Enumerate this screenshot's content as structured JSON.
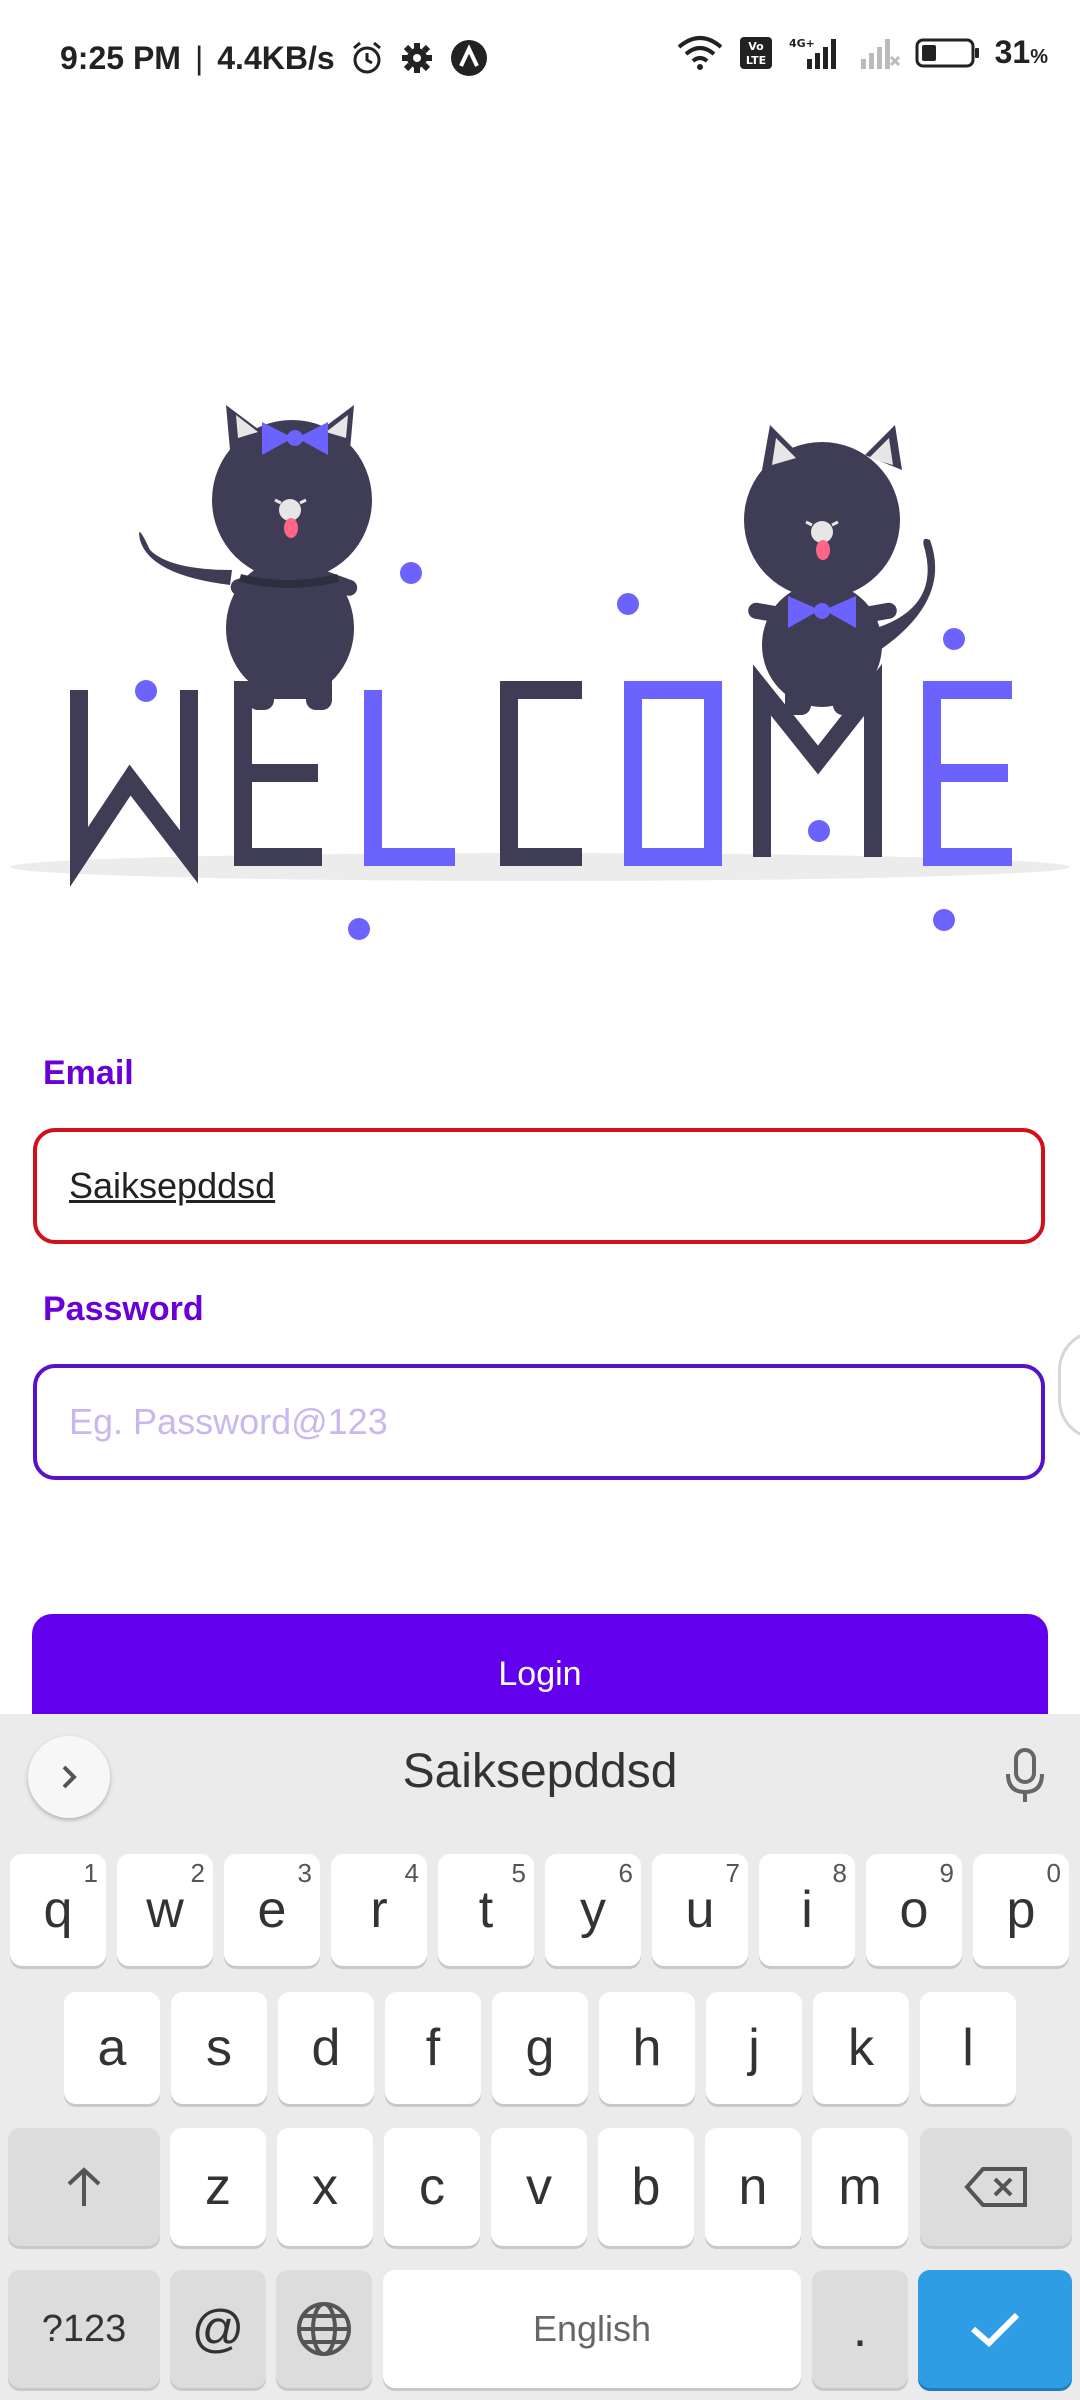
{
  "status_bar": {
    "time": "9:25 PM",
    "separator": "|",
    "speed": "4.4KB/s",
    "battery_percent": "31",
    "battery_unit": "%",
    "net_type": "4G+",
    "volte": "Vo LTE"
  },
  "form": {
    "email_label": "Email",
    "email_value": "Saiksepddsd",
    "password_label": "Password",
    "password_placeholder": "Eg. Password@123",
    "login_label": "Login"
  },
  "keyboard": {
    "suggestion": "Saiksepddsd",
    "row1": [
      {
        "key": "q",
        "hint": "1"
      },
      {
        "key": "w",
        "hint": "2"
      },
      {
        "key": "e",
        "hint": "3"
      },
      {
        "key": "r",
        "hint": "4"
      },
      {
        "key": "t",
        "hint": "5"
      },
      {
        "key": "y",
        "hint": "6"
      },
      {
        "key": "u",
        "hint": "7"
      },
      {
        "key": "i",
        "hint": "8"
      },
      {
        "key": "o",
        "hint": "9"
      },
      {
        "key": "p",
        "hint": "0"
      }
    ],
    "row2": [
      "a",
      "s",
      "d",
      "f",
      "g",
      "h",
      "j",
      "k",
      "l"
    ],
    "row3": [
      "z",
      "x",
      "c",
      "v",
      "b",
      "n",
      "m"
    ],
    "symbols_label": "?123",
    "at_label": "@",
    "space_label": "English",
    "period_label": "."
  },
  "colors": {
    "accent": "#6200ee",
    "label_purple": "#6a00d9",
    "error_red": "#d0101a",
    "illustration_dark": "#3f3d56",
    "illustration_purple": "#6c63ff",
    "keyboard_blue": "#2f9de6"
  }
}
